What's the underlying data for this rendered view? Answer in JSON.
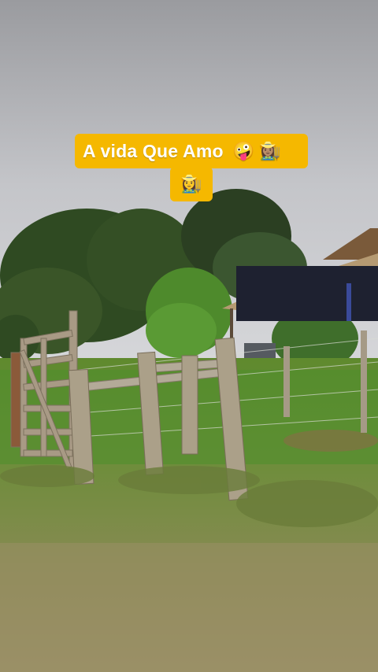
{
  "caption": {
    "text": "A vida Que Amo",
    "emoji_1": "🤪",
    "emoji_2": "👩🏽‍🌾",
    "emoji_3": "👩‍🌾",
    "background_color": "#f5b800",
    "text_color": "#ffffff"
  },
  "scene": {
    "description_icons": [
      "sky",
      "trees",
      "barn-roof",
      "wooden-gate",
      "fence-posts",
      "grass"
    ]
  }
}
